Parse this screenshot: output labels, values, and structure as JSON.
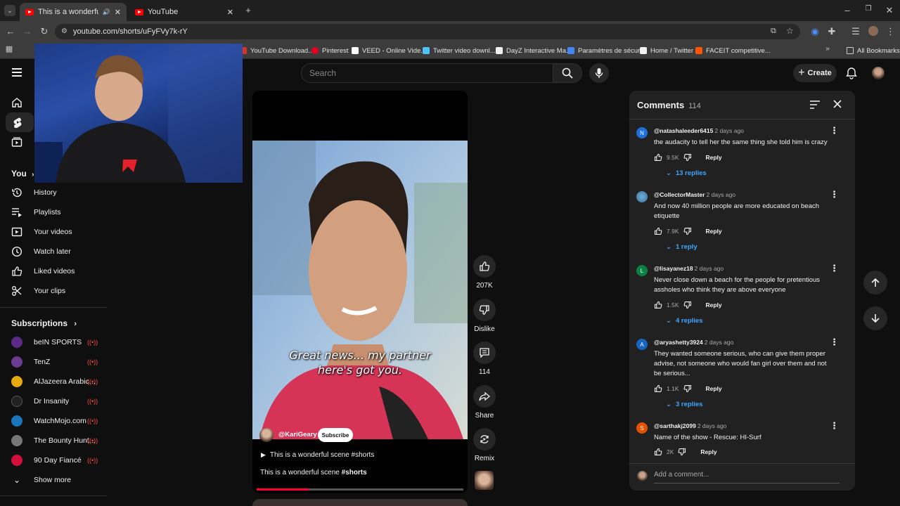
{
  "browser": {
    "tabs": [
      {
        "title": "This is a wonderful scene #s",
        "active": true
      },
      {
        "title": "YouTube",
        "active": false
      }
    ],
    "url": "youtube.com/shorts/uFyFVy7k-rY",
    "bookmarks": [
      {
        "label": "YouTube Download...",
        "color": "#d93025"
      },
      {
        "label": "Pinterest",
        "color": "#e60023"
      },
      {
        "label": "VEED - Online Vide...",
        "color": "#ffffff"
      },
      {
        "label": "Twitter video downl...",
        "color": "#4cc2ff"
      },
      {
        "label": "DayZ Interactive Ma...",
        "color": "#f1f1f1"
      },
      {
        "label": "Paramètres de sécur...",
        "color": "#4285f4"
      },
      {
        "label": "Home / Twitter",
        "color": "#f1f1f1"
      },
      {
        "label": "FACEIT competitive...",
        "color": "#ff5500"
      }
    ],
    "all_bookmarks": "All Bookmarks"
  },
  "header": {
    "search_placeholder": "Search",
    "create_label": "Create"
  },
  "sidebar": {
    "you_label": "You",
    "you_items": [
      {
        "label": "History",
        "icon": "history-icon"
      },
      {
        "label": "Playlists",
        "icon": "playlists-icon"
      },
      {
        "label": "Your videos",
        "icon": "your-videos-icon"
      },
      {
        "label": "Watch later",
        "icon": "watch-later-icon"
      },
      {
        "label": "Liked videos",
        "icon": "liked-videos-icon"
      },
      {
        "label": "Your clips",
        "icon": "clips-icon"
      }
    ],
    "subscriptions_label": "Subscriptions",
    "subscriptions": [
      {
        "label": "beIN SPORTS",
        "color": "#5b2a86"
      },
      {
        "label": "TenZ",
        "color": "#6a3b8f"
      },
      {
        "label": "AlJazeera Arabic...",
        "color": "#e8a90c"
      },
      {
        "label": "Dr Insanity",
        "color": "#222222"
      },
      {
        "label": "WatchMojo.com",
        "color": "#1b75bb"
      },
      {
        "label": "The Bounty Hunt...",
        "color": "#777777"
      },
      {
        "label": "90 Day Fiancé",
        "color": "#d3103b"
      }
    ],
    "show_more": "Show more"
  },
  "short": {
    "caption_line1": "Great news... my partner",
    "caption_line2": "here's got you.",
    "channel": "@KariGeary",
    "subscribe_label": "Subscribe",
    "playlist_title": "This is a wonderful scene #shorts",
    "description_text": "This is a wonderful scene ",
    "description_tag": "#shorts",
    "progress": 0.25
  },
  "actions": {
    "likes": "207K",
    "dislike_label": "Dislike",
    "comments": "114",
    "share_label": "Share",
    "remix_label": "Remix"
  },
  "comments_panel": {
    "title": "Comments",
    "count": "114",
    "add_placeholder": "Add a comment...",
    "reply_label": "Reply",
    "items": [
      {
        "initial": "N",
        "avatar_color": "#1e6fd9",
        "author": "@natashaleeder6415",
        "time": "2 days ago",
        "text": "the audacity to tell her the same thing she told him is crazy",
        "likes": "9.5K",
        "replies": "13 replies"
      },
      {
        "initial": "",
        "avatar_color": "#4a90c2",
        "author": "@CollectorMaster",
        "time": "2 days ago",
        "text": "And now 40 million people are more educated on beach etiquette",
        "likes": "7.9K",
        "replies": "1 reply"
      },
      {
        "initial": "L",
        "avatar_color": "#0b8043",
        "author": "@lisayanez18",
        "time": "2 days ago",
        "text": "Never close down a beach for the people for pretentious assholes who think they are above everyone",
        "likes": "1.5K",
        "replies": "4 replies"
      },
      {
        "initial": "A",
        "avatar_color": "#1565c0",
        "author": "@aryashetty3924",
        "time": "2 days ago",
        "text": "They wanted someone serious, who can give them proper advise, not someone who would fan girl over them and not be serious...",
        "likes": "1.1K",
        "replies": "3 replies"
      },
      {
        "initial": "S",
        "avatar_color": "#e65100",
        "author": "@sarthakj2099",
        "time": "2 days ago",
        "text": "Name of the show - Rescue: HI-Surf",
        "likes": "2K",
        "replies": ""
      }
    ]
  }
}
